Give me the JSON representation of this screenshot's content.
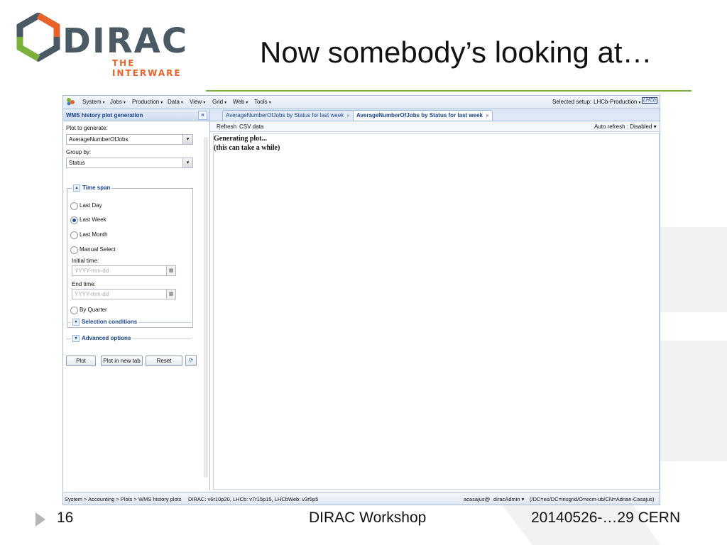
{
  "slide": {
    "logo": {
      "name": "DIRAC",
      "tagline": "THE INTERWARE"
    },
    "title": "Now somebody’s looking at…",
    "footer": {
      "page_number": "16",
      "center": "DIRAC Workshop",
      "right": "20140526-…29 CERN"
    },
    "colors": {
      "accent_green": "#7ab23a",
      "logo_orange": "#e8622a",
      "logo_gray": "#4a5a65"
    }
  },
  "app": {
    "menubar": {
      "items": [
        "System",
        "Jobs",
        "Production",
        "Data",
        "View",
        "Grid",
        "Web",
        "Tools"
      ],
      "selected_setup_label": "Selected setup:",
      "setup_value": "LHCb-Production",
      "brand": "LHCb"
    },
    "left_panel": {
      "title": "WMS history plot generation",
      "plot_to_generate_label": "Plot to generate:",
      "plot_value": "AverageNumberOfJobs",
      "group_by_label": "Group by:",
      "group_value": "Status",
      "time_span": {
        "legend": "Time span",
        "options": [
          "Last Day",
          "Last Week",
          "Last Month",
          "Manual Select"
        ],
        "selected": "Last Week",
        "initial_time_label": "Initial time:",
        "initial_placeholder": "YYYY-mm-dd",
        "end_time_label": "End time:",
        "end_placeholder": "YYYY-mm-dd",
        "by_quarter": "By Quarter"
      },
      "selection_conditions": "Selection conditions",
      "advanced_options": "Advanced options",
      "buttons": {
        "plot": "Plot",
        "plot_new_tab": "Plot in new tab",
        "reset": "Reset"
      }
    },
    "tabs": [
      {
        "label": "AverageNumberOfJobs by Status for last week",
        "active": false
      },
      {
        "label": "AverageNumberOfJobs by Status for last week",
        "active": true
      }
    ],
    "toolbar": {
      "refresh": "Refresh",
      "csv": "CSV data",
      "auto_refresh": "Auto refresh : Disabled"
    },
    "content": {
      "line1": "Generating plot...",
      "line2": "(this can take a while)"
    },
    "statusbar": {
      "path": "System > Accounting > Plots > WMS history plots",
      "versions": "DIRAC: v6r10p20, LHCb: v7r15p15, LHCbWeb: v3r5p5",
      "user": "acasajus@",
      "role": "diracAdmin",
      "dn": "(/DC=es/DC=irisgrid/O=ecm-ub/CN=Adrian-Casajus)"
    }
  }
}
